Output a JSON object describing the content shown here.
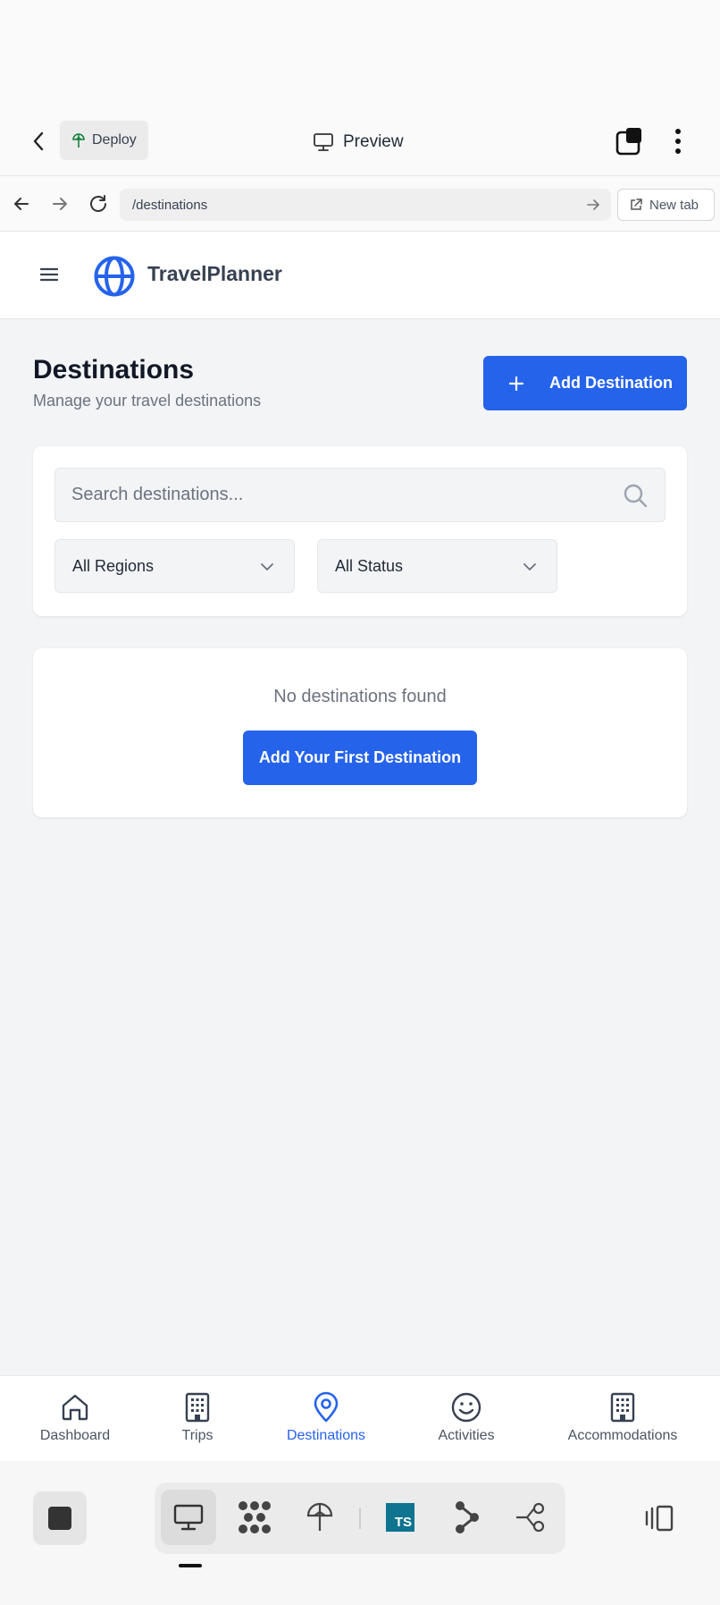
{
  "topbar": {
    "deploy_label": "Deploy",
    "title": "Preview"
  },
  "urlbar": {
    "url": "/destinations",
    "new_tab_label": "New tab"
  },
  "app": {
    "brand": "TravelPlanner",
    "accent_color": "#2563eb"
  },
  "page": {
    "title": "Destinations",
    "subtitle": "Manage your travel destinations",
    "add_button": "Add Destination"
  },
  "filters": {
    "search_placeholder": "Search destinations...",
    "search_value": "",
    "region_selected": "All Regions",
    "status_selected": "All Status"
  },
  "empty_state": {
    "message": "No destinations found",
    "button": "Add Your First Destination"
  },
  "bottom_nav": {
    "items": [
      {
        "label": "Dashboard",
        "icon": "home-icon"
      },
      {
        "label": "Trips",
        "icon": "building-icon"
      },
      {
        "label": "Destinations",
        "icon": "map-pin-icon",
        "active": true
      },
      {
        "label": "Activities",
        "icon": "smiley-icon"
      },
      {
        "label": "Accommodations",
        "icon": "hotel-icon"
      }
    ]
  },
  "ide_toolbar": {
    "ts_badge": "TS"
  }
}
